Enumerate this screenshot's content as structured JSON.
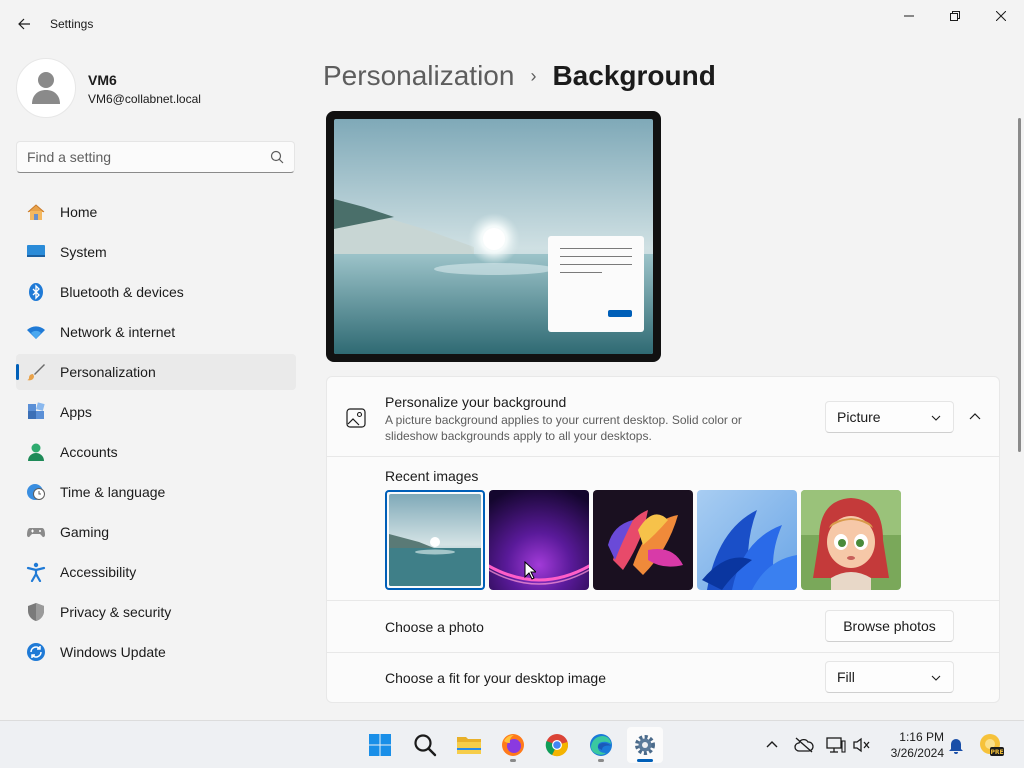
{
  "window": {
    "title": "Settings"
  },
  "user": {
    "name": "VM6",
    "email": "VM6@collabnet.local"
  },
  "search": {
    "placeholder": "Find a setting"
  },
  "sidebar": {
    "items": [
      {
        "label": "Home",
        "icon": "home-icon"
      },
      {
        "label": "System",
        "icon": "system-icon"
      },
      {
        "label": "Bluetooth & devices",
        "icon": "bluetooth-icon"
      },
      {
        "label": "Network & internet",
        "icon": "wifi-icon"
      },
      {
        "label": "Personalization",
        "icon": "paintbrush-icon",
        "active": true
      },
      {
        "label": "Apps",
        "icon": "apps-icon"
      },
      {
        "label": "Accounts",
        "icon": "accounts-icon"
      },
      {
        "label": "Time & language",
        "icon": "clock-globe-icon"
      },
      {
        "label": "Gaming",
        "icon": "gamepad-icon"
      },
      {
        "label": "Accessibility",
        "icon": "accessibility-icon"
      },
      {
        "label": "Privacy & security",
        "icon": "shield-icon"
      },
      {
        "label": "Windows Update",
        "icon": "update-icon"
      }
    ]
  },
  "breadcrumb": {
    "parent": "Personalization",
    "separator": "›",
    "current": "Background"
  },
  "background": {
    "title": "Personalize your background",
    "description": "A picture background applies to your current desktop. Solid color or slideshow backgrounds apply to all your desktops.",
    "type_value": "Picture",
    "recent_label": "Recent images",
    "recent_images": [
      {
        "name": "lake-sunrise",
        "selected": true
      },
      {
        "name": "purple-glow",
        "selected": false
      },
      {
        "name": "colorful-petals",
        "selected": false
      },
      {
        "name": "blue-bloom",
        "selected": false
      },
      {
        "name": "cartoon-girl",
        "selected": false
      }
    ],
    "choose_photo_label": "Choose a photo",
    "browse_label": "Browse photos",
    "fit_label": "Choose a fit for your desktop image",
    "fit_value": "Fill"
  },
  "taskbar": {
    "time": "1:16 PM",
    "date": "3/26/2024",
    "apps": [
      "start",
      "search",
      "file-explorer",
      "firefox",
      "chrome",
      "edge",
      "settings"
    ]
  },
  "colors": {
    "accent": "#005fb8"
  }
}
